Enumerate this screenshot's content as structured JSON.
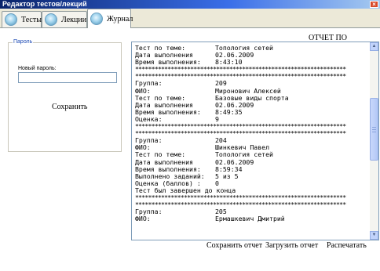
{
  "window": {
    "title": "Редактор тестов/лекций",
    "close_glyph": "×"
  },
  "tabs": [
    {
      "label": "Тесты",
      "icon": "globe-icon"
    },
    {
      "label": "Лекции",
      "icon": "globe-icon"
    },
    {
      "label": "Журнал",
      "icon": "globe-icon"
    }
  ],
  "active_tab": "Журнал",
  "password_group": {
    "legend": "Пароль",
    "new_password_label": "Новый пароль:",
    "new_password_value": "",
    "save_label": "Сохранить"
  },
  "report": {
    "title": "ОТЧЕТ ПО ТЕСТАМ:",
    "lines": [
      {
        "k": "Тест по теме:",
        "v": "Топология сетей"
      },
      {
        "k": "Дата выполнения",
        "v": "02.06.2009"
      },
      {
        "k": "Время выполнения:",
        "v": "8:43:10"
      },
      {
        "k": "*****************************************************************",
        "v": ""
      },
      {
        "k": "*****************************************************************",
        "v": ""
      },
      {
        "k": "Группа:",
        "v": "209"
      },
      {
        "k": "ФИО:",
        "v": "Миронович Алексей"
      },
      {
        "k": "Тест по теме:",
        "v": "Базовые виды спорта"
      },
      {
        "k": "Дата выполнения",
        "v": "02.06.2009"
      },
      {
        "k": "Время выполнения:",
        "v": "8:49:35"
      },
      {
        "k": "Оценка:",
        "v": "9"
      },
      {
        "k": "*****************************************************************",
        "v": ""
      },
      {
        "k": "*****************************************************************",
        "v": ""
      },
      {
        "k": "Группа:",
        "v": "204"
      },
      {
        "k": "ФИО:",
        "v": "Шинкевич Павел"
      },
      {
        "k": "Тест по теме:",
        "v": "Топология сетей"
      },
      {
        "k": "Дата выполнения",
        "v": "02.06.2009"
      },
      {
        "k": "Время выполнения:",
        "v": "8:59:34"
      },
      {
        "k": "Выполнено заданий:",
        "v": "5 из 5"
      },
      {
        "k": "Оценка (баллов) :",
        "v": "0"
      },
      {
        "k": "Тест был завершен до конца",
        "v": ""
      },
      {
        "k": "*****************************************************************",
        "v": ""
      },
      {
        "k": "*****************************************************************",
        "v": ""
      },
      {
        "k": "Группа:",
        "v": "205"
      },
      {
        "k": "ФИО:",
        "v": "Ермашкевич Дмитрий"
      }
    ]
  },
  "buttons": {
    "save_report": "Сохранить отчет",
    "load_report": "Загрузить отчет",
    "print": "Распечатать"
  }
}
